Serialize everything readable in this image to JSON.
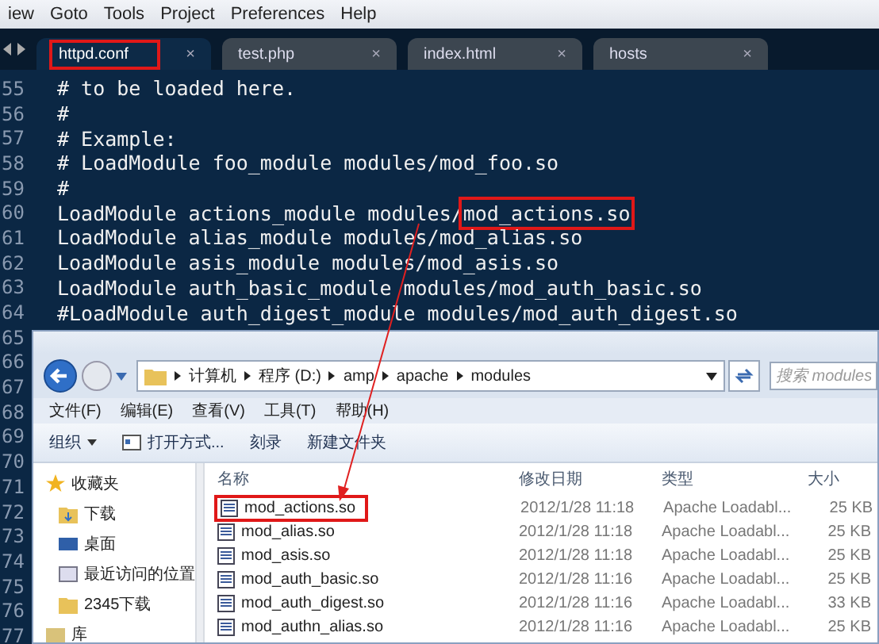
{
  "menu_bar": [
    "iew",
    "Goto",
    "Tools",
    "Project",
    "Preferences",
    "Help"
  ],
  "tabs": [
    {
      "label": "httpd.conf",
      "close": "×",
      "selected": true,
      "boxed": true
    },
    {
      "label": "test.php",
      "close": "×",
      "selected": false,
      "boxed": false
    },
    {
      "label": "index.html",
      "close": "×",
      "selected": false,
      "boxed": false
    },
    {
      "label": "hosts",
      "close": "×",
      "selected": false,
      "boxed": false
    }
  ],
  "code_lines": [
    {
      "num": "55",
      "text": "# to be loaded here."
    },
    {
      "num": "56",
      "text": "#"
    },
    {
      "num": "57",
      "text": "# Example:"
    },
    {
      "num": "58",
      "text": "# LoadModule foo_module modules/mod_foo.so"
    },
    {
      "num": "59",
      "text": "#"
    },
    {
      "num": "60",
      "text": "LoadModule actions_module modules/",
      "boxed": "mod_actions.so"
    },
    {
      "num": "61",
      "text": "LoadModule alias_module modules/mod_alias.so"
    },
    {
      "num": "62",
      "text": "LoadModule asis_module modules/mod_asis.so"
    },
    {
      "num": "63",
      "text": "LoadModule auth_basic_module modules/mod_auth_basic.so"
    },
    {
      "num": "64",
      "text": "#LoadModule auth_digest_module modules/mod_auth_digest.so"
    },
    {
      "num": "65"
    },
    {
      "num": "66"
    },
    {
      "num": "67"
    },
    {
      "num": "68"
    },
    {
      "num": "69"
    },
    {
      "num": "70"
    },
    {
      "num": "71"
    },
    {
      "num": "72"
    },
    {
      "num": "73"
    },
    {
      "num": "74"
    },
    {
      "num": "75"
    },
    {
      "num": "76"
    },
    {
      "num": "77"
    }
  ],
  "explorer": {
    "address": [
      "计算机",
      "程序 (D:)",
      "amp",
      "apache",
      "modules"
    ],
    "search": {
      "placeholder": "搜索 modules"
    },
    "menu": [
      "文件(F)",
      "编辑(E)",
      "查看(V)",
      "工具(T)",
      "帮助(H)"
    ],
    "toolbar": [
      {
        "kind": "dropdown",
        "label": "组织"
      },
      {
        "kind": "icon",
        "label": "打开方式..."
      },
      {
        "kind": "plain",
        "label": "刻录"
      },
      {
        "kind": "plain",
        "label": "新建文件夹"
      }
    ],
    "sidebar": [
      {
        "kind": "star",
        "label": "收藏夹",
        "children": [
          {
            "kind": "download",
            "label": "下载"
          },
          {
            "kind": "desktop",
            "label": "桌面"
          },
          {
            "kind": "recent",
            "label": "最近访问的位置"
          },
          {
            "kind": "folder",
            "label": "2345下载"
          }
        ]
      },
      {
        "kind": "library",
        "label": "库"
      }
    ],
    "columns": [
      "名称",
      "修改日期",
      "类型",
      "大小"
    ],
    "files": [
      {
        "name": "mod_actions.so",
        "date": "2012/1/28 11:18",
        "type": "Apache Loadabl...",
        "size": "25 KB",
        "boxed": true
      },
      {
        "name": "mod_alias.so",
        "date": "2012/1/28 11:18",
        "type": "Apache Loadabl...",
        "size": "25 KB",
        "boxed": false
      },
      {
        "name": "mod_asis.so",
        "date": "2012/1/28 11:18",
        "type": "Apache Loadabl...",
        "size": "25 KB",
        "boxed": false
      },
      {
        "name": "mod_auth_basic.so",
        "date": "2012/1/28 11:16",
        "type": "Apache Loadabl...",
        "size": "25 KB",
        "boxed": false
      },
      {
        "name": "mod_auth_digest.so",
        "date": "2012/1/28 11:16",
        "type": "Apache Loadabl...",
        "size": "33 KB",
        "boxed": false
      },
      {
        "name": "mod_authn_alias.so",
        "date": "2012/1/28 11:16",
        "type": "Apache Loadabl...",
        "size": "25 KB",
        "boxed": false
      }
    ]
  }
}
